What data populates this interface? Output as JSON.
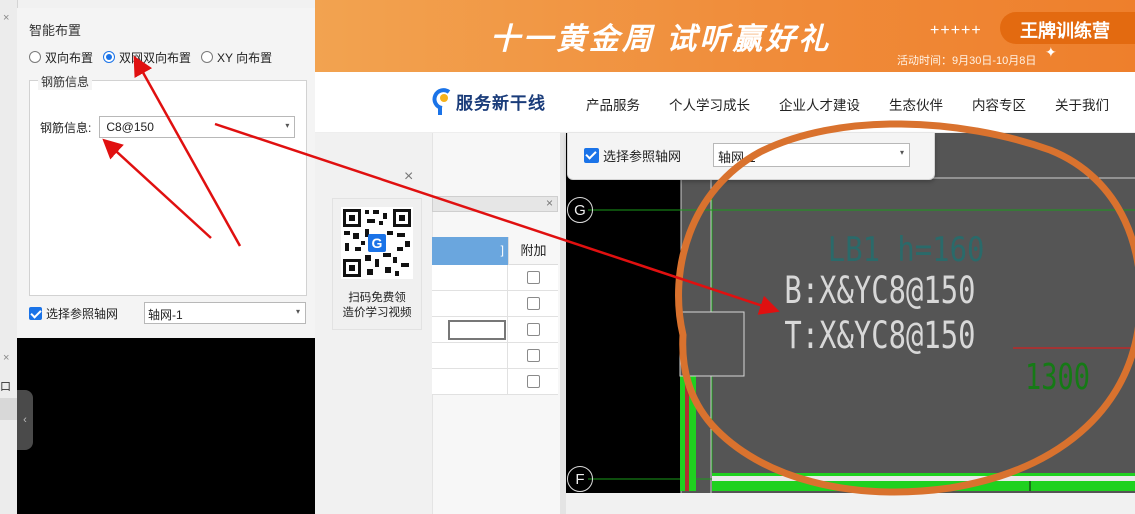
{
  "left_gutter": {
    "tab_text": "口"
  },
  "dialog": {
    "title": "智能布置",
    "layout_options": [
      {
        "label": "双向布置",
        "selected": false
      },
      {
        "label": "双网双向布置",
        "selected": true
      },
      {
        "label": "XY 向布置",
        "selected": false
      }
    ],
    "rebar_group": {
      "legend": "钢筋信息",
      "field_label": "钢筋信息:",
      "field_value": "C8@150"
    },
    "reference_axis": {
      "label": "选择参照轴网",
      "checked": true,
      "value": "轴网-1"
    }
  },
  "banner": {
    "headline": "十一黄金周  试听赢好礼",
    "stars": "+++++",
    "dates": "活动时间：9月30日-10月8日",
    "pill": "王牌训练营"
  },
  "nav": {
    "brand": "服务新干线",
    "items": [
      "产品服务",
      "个人学习成长",
      "企业人才建设",
      "生态伙伴",
      "内容专区",
      "关于我们"
    ]
  },
  "qr_popup": {
    "line1": "扫码免费领",
    "line2": "造价学习视频",
    "close": "×"
  },
  "table": {
    "header_close": "×",
    "header_partial": "]",
    "column_header": "附加",
    "rows": [
      {
        "checked": false
      },
      {
        "checked": false
      },
      {
        "checked": false
      },
      {
        "checked": false
      },
      {
        "checked": false
      }
    ]
  },
  "cad": {
    "ref_dropdown": {
      "label": "选择参照轴网",
      "checked": true,
      "value": "轴网-1"
    },
    "axis_labels": [
      "G",
      "F"
    ],
    "slab_label": "LB1  h=160",
    "bottom_rebar": "B:X&YC8@150",
    "top_rebar": "T:X&YC8@150",
    "dimension": "1300"
  },
  "colors": {
    "accent_blue": "#1a73e8",
    "banner_orange": "#f08c3a",
    "annotation_red": "#e01010",
    "annotation_orange": "#d9722e",
    "cad_bg": "#555555",
    "cad_green": "#1fd11f"
  }
}
